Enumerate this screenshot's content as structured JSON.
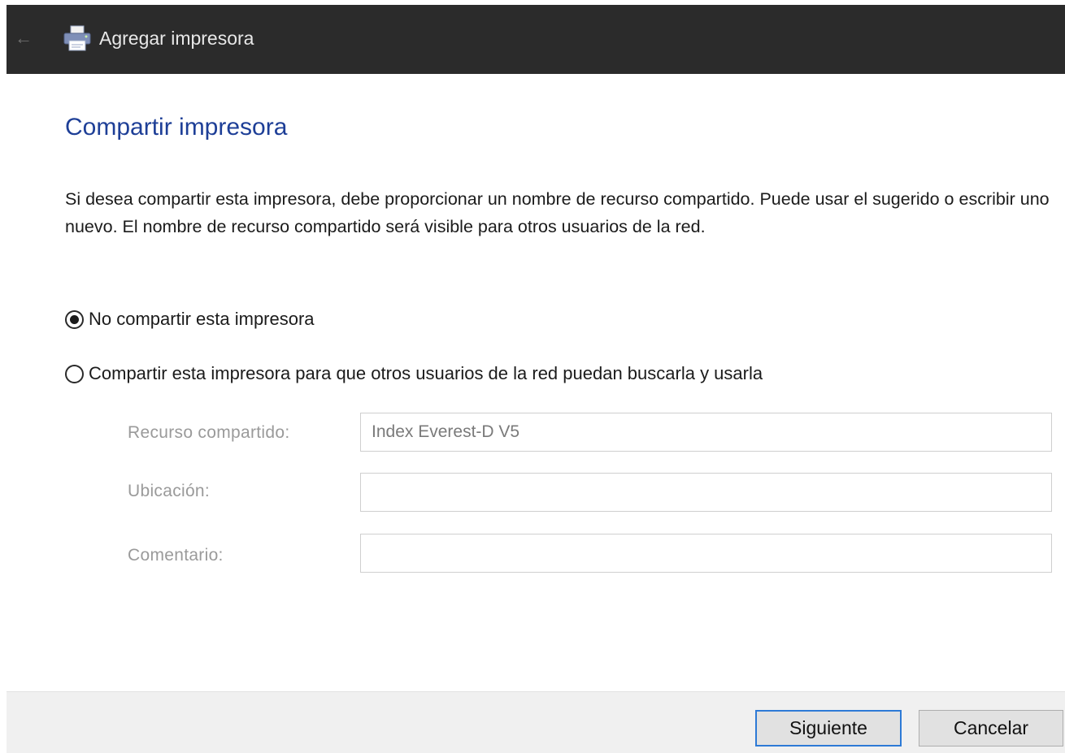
{
  "window": {
    "title": "Agregar impresora",
    "back_icon": "arrow-left-icon",
    "app_icon": "printer-icon"
  },
  "page": {
    "heading": "Compartir impresora",
    "description": "Si desea compartir esta impresora, debe proporcionar un nombre de recurso compartido. Puede usar el sugerido o escribir uno nuevo. El nombre de recurso compartido será visible para otros usuarios de la red."
  },
  "options": {
    "no_share": {
      "label": "No compartir esta impresora",
      "selected": true
    },
    "share": {
      "label": "Compartir esta impresora para que otros usuarios de la red puedan buscarla y usarla",
      "selected": false
    }
  },
  "fields": {
    "share_name": {
      "label": "Recurso compartido:",
      "value": "Index Everest-D V5"
    },
    "location": {
      "label": "Ubicación:",
      "value": ""
    },
    "comment": {
      "label": "Comentario:",
      "value": ""
    }
  },
  "buttons": {
    "next": "Siguiente",
    "cancel": "Cancelar"
  },
  "colors": {
    "titlebar": "#2b2b2b",
    "heading": "#1e3f97",
    "primary_border": "#2d7ad6"
  }
}
